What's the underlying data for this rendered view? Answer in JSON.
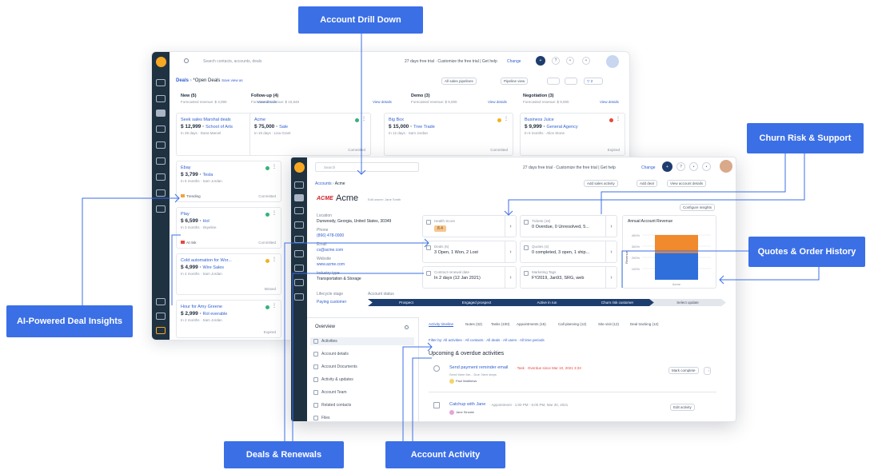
{
  "callouts": {
    "account_drill_down": "Account Drill Down",
    "churn_risk": "Churn Risk & Support",
    "quotes_orders": "Quotes & Order History",
    "ai_insights": "AI-Powered Deal Insights",
    "deals_renewals": "Deals & Renewals",
    "account_activity": "Account Activity"
  },
  "colors": {
    "callout": "#3b6fe6",
    "sidebar": "#1f3242",
    "accent": "#2f5fd0",
    "logo": "#f7a823"
  },
  "back": {
    "search_placeholder": "Search contacts, accounts, deals",
    "trial_text": "27 days free trial · Customize the free trial | Get help",
    "change": "Change",
    "breadcrumb_deals": "Deals",
    "breadcrumb_view": "*Open Deals",
    "save_view": "Save view as",
    "filter_all": "All sales pipelines",
    "stage_view": "Pipeline view",
    "filter_count": "2",
    "columns": [
      {
        "title": "New (5)",
        "sub": "Forecasted revenue: $ 3,090",
        "link": "View details"
      },
      {
        "title": "Follow-up (4)",
        "sub": "Forecasted revenue: $ 10,848",
        "link": "View details"
      },
      {
        "title": "Demo (3)",
        "sub": "Forecasted revenue: $ 9,000",
        "link": "View details"
      },
      {
        "title": "Negotiation (3)",
        "sub": "Forecasted revenue: $ 9,000",
        "link": "View details"
      }
    ],
    "cards": [
      {
        "name": "Seek sales Marshal deals",
        "value": "$ 12,999",
        "owner": "School of Arts",
        "sub": "In 28 days · Dana Marvel",
        "status": "Expired"
      },
      {
        "name": "Acme",
        "value": "$ 75,000",
        "owner": "Sale",
        "sub": "In 15 days · Lisa Grant",
        "status": "Committed"
      },
      {
        "name": "Big Box",
        "value": "$ 15,000",
        "owner": "Tree Trade",
        "sub": "In 12 days · Sam Jordan",
        "status": "Committed"
      },
      {
        "name": "Business Juice",
        "value": "$ 9,999",
        "owner": "General Agency",
        "sub": "In 6 months · Alice Stone",
        "status": "Expired"
      },
      {
        "name": "Ebay",
        "value": "$ 3,799",
        "owner": "Tesla",
        "sub": "In 5 months · Sam Jordan",
        "status": "Committed",
        "flag": "Trending"
      },
      {
        "name": "Play",
        "value": "$ 6,599",
        "owner": "Hol",
        "sub": "In 3 months · Skyeline",
        "status": "Committed",
        "flag": "At risk"
      },
      {
        "name": "Cold automation for Wor...",
        "value": "$ 4,999",
        "owner": "Wire Sales",
        "sub": "In 4 months · Sam Jordan",
        "status": "Missed"
      },
      {
        "name": "Hour for Amy Greene",
        "value": "$ 2,999",
        "owner": "Rol everable",
        "sub": "In 2 months · Sam Jordan",
        "status": "Expired"
      }
    ]
  },
  "front": {
    "search_placeholder": "Search",
    "trial_text": "27 days free trial · Customize the free trial | Get help",
    "change": "Change",
    "breadcrumb_accounts": "Accounts",
    "breadcrumb_acme": "Acme",
    "add_activity": "Add sales activity",
    "add_deal": "Add deal",
    "view_details": "View account details",
    "logo_text": "ACME",
    "account_name": "Acme",
    "owner_text": "Edit owner: Jane Smith",
    "config_btn": "Configure insights",
    "location_label": "Location",
    "location_val": "Dunwoody, Georgia, United States, 30349",
    "phone_label": "Phone",
    "phone_val": "(866) 478-0900",
    "email_label": "Email",
    "email_val": "cs@acme.com",
    "website_label": "Website",
    "website_val": "www.acme.com",
    "industry_label": "Industry type",
    "industry_val": "Transportation & Storage",
    "health_label": "Health Score",
    "health_val": "8.4",
    "deals_label": "Deals (6)",
    "deals_val": "3 Open, 1 Won, 2 Lost",
    "renewal_label": "Contract renewal date",
    "renewal_val": "In 2 days (12 Jan 2021)",
    "tickets_label": "Tickets (19)",
    "tickets_val": "0 Overdue, 0 Unresolved, 5...",
    "quotes_label": "Quotes (4)",
    "quotes_val": "0 completed, 3 open, 1 ship...",
    "marketing_label": "Marketing Tags",
    "marketing_val": "FY2019, Jan93, SRG, web",
    "chart_title": "Annual Account Revenue",
    "lifecycle_label": "Lifecycle stage",
    "lifecycle_val": "Paying customer",
    "status_label": "Account status",
    "stages": [
      "Prospect",
      "Engaged prospect",
      "Active in run",
      "Churn risk customer",
      "Select update"
    ],
    "overview_title": "Overview",
    "overview_items": [
      "Activities",
      "Account details",
      "Account Documents",
      "Activity & updates",
      "Account Team",
      "Related contacts",
      "Files"
    ],
    "tabs": [
      "Activity timeline",
      "Notes (32)",
      "Tasks (100)",
      "Appointments (15)",
      "Call planning (12)",
      "Site visit (12)",
      "Deal tracking (12)"
    ],
    "filter_text": "Filter by:  All activities · All contacts · All deals · All users · All time periods",
    "upcoming_title": "Upcoming & overdue activities",
    "activity1": "Send payment reminder email",
    "activity1_meta": "· Task · Overdue since Mar 10, 2021 3:33",
    "activity1_sub": "Send them the... Due: Next steps",
    "activity1_user": "Paul Matthews",
    "mark_complete": "Mark complete",
    "activity2": "Catchup with Jane",
    "activity2_meta": "· Appointment · 1:00 PM - 5:00 PM, Mar 30, 2021",
    "activity2_user": "Jane Sinclair",
    "edit_activity": "Edit activity"
  },
  "chart_data": {
    "type": "bar",
    "title": "Annual Account Revenue",
    "ylabel": "Revenue",
    "categories": [
      "Acme"
    ],
    "series": [
      {
        "name": "",
        "color": "#2f6fdb",
        "values": [
          600
        ]
      },
      {
        "name": "",
        "color": "#f08a2c",
        "values": [
          400
        ]
      }
    ],
    "yticks": [
      "400%",
      "300%",
      "200%",
      "100%"
    ],
    "stacked": true,
    "grid": true
  }
}
